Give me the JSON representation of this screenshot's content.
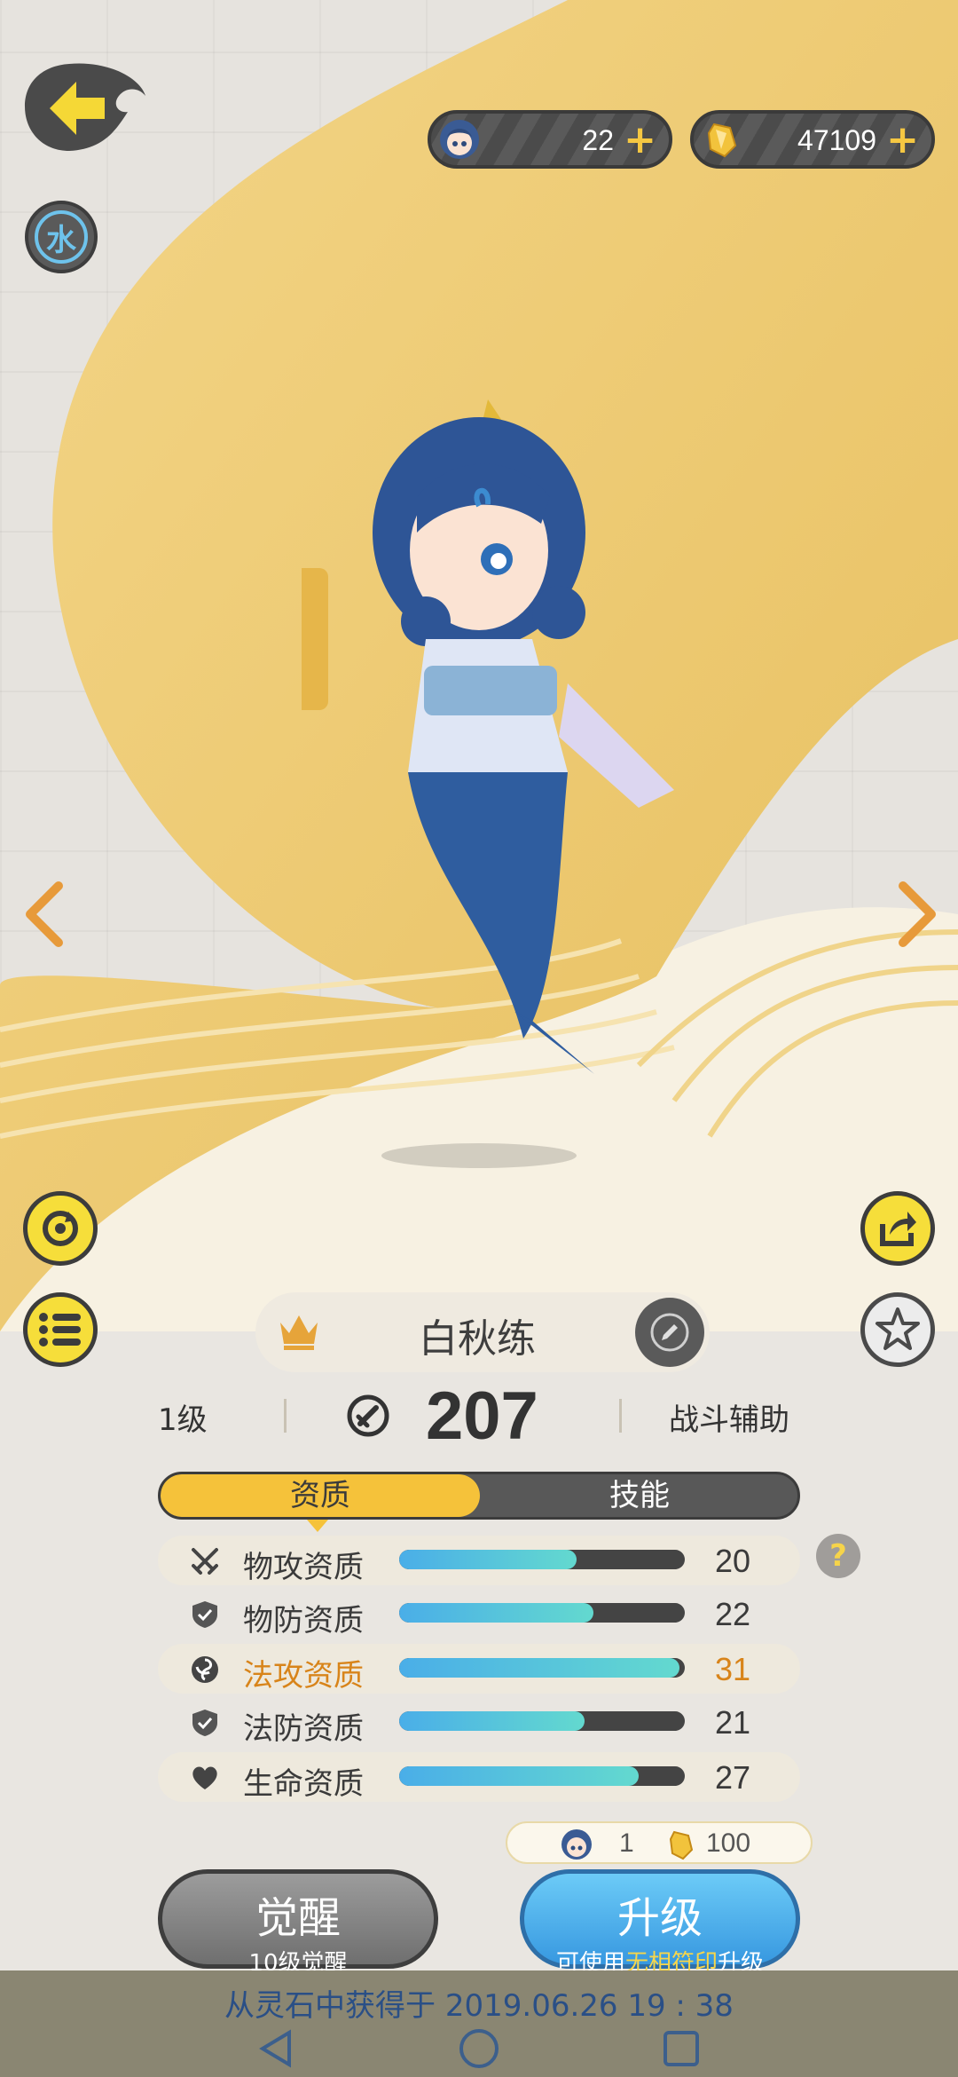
{
  "element": {
    "label": "水"
  },
  "currencies": [
    {
      "icon": "spirit-face-icon",
      "value": "22",
      "plus": "+"
    },
    {
      "icon": "gold-crystal-icon",
      "value": "47109",
      "plus": "+"
    }
  ],
  "pet": {
    "name": "白秋练",
    "level": "1级",
    "power": "207",
    "role": "战斗辅助"
  },
  "tabs": {
    "active": "资质",
    "inactive": "技能"
  },
  "attributes": [
    {
      "label": "物攻资质",
      "value": "20",
      "fill": 0.62,
      "icon": "crossed-swords-icon"
    },
    {
      "label": "物防资质",
      "value": "22",
      "fill": 0.68,
      "icon": "shield-icon"
    },
    {
      "label": "法攻资质",
      "value": "31",
      "fill": 0.98,
      "icon": "swirl-icon",
      "highlighted": true
    },
    {
      "label": "法防资质",
      "value": "21",
      "fill": 0.65,
      "icon": "shield-icon"
    },
    {
      "label": "生命资质",
      "value": "27",
      "fill": 0.84,
      "icon": "heart-icon"
    }
  ],
  "help": "?",
  "cost": {
    "spirit": "1",
    "gold": "100"
  },
  "buttons": {
    "awaken": {
      "main": "觉醒",
      "sub": "10级觉醒"
    },
    "upgrade": {
      "main": "升级",
      "sub_prefix": "可使用",
      "sub_highlight": "无相符印",
      "sub_suffix": "升级"
    }
  },
  "acquired": "从灵石中获得于 2019.06.26  19 : 38",
  "colors": {
    "accent": "#f5c23a",
    "highlight": "#d8841a",
    "bar_start": "#4aaee8",
    "bar_end": "#63d9cf"
  }
}
